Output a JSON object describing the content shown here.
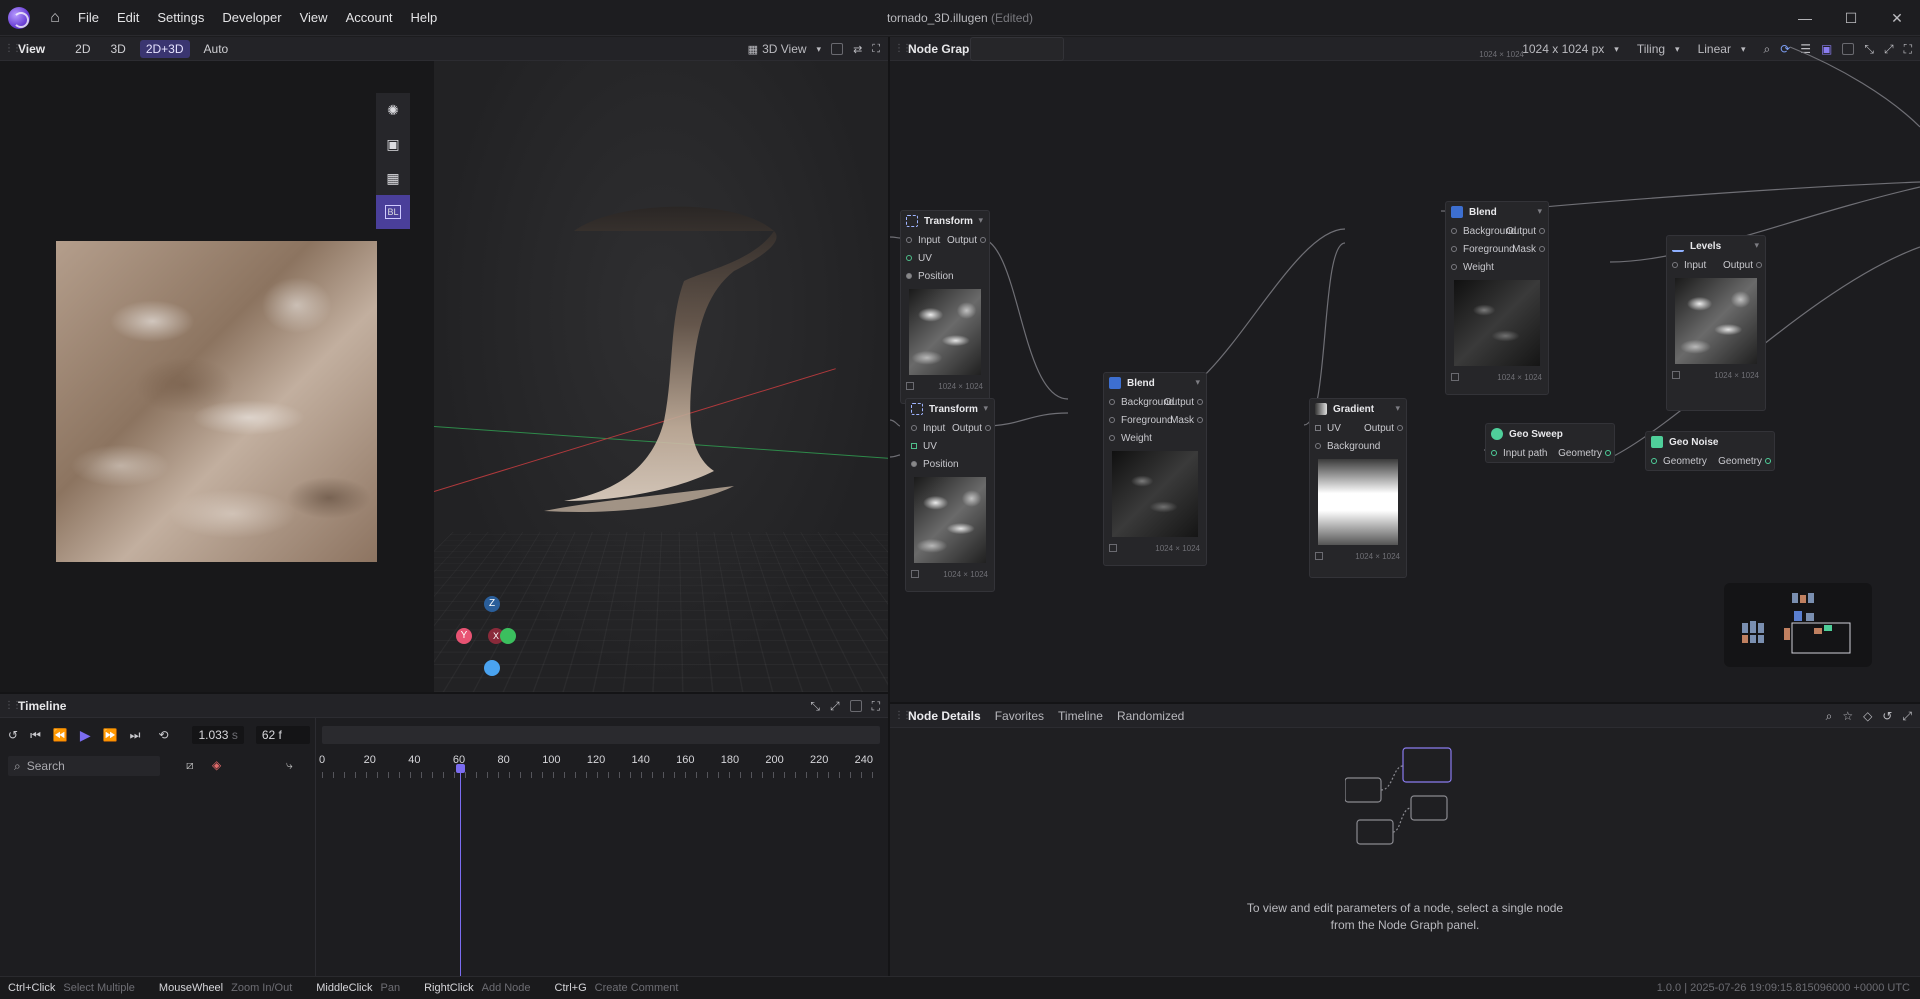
{
  "app": {
    "title": "tornado_3D.illugen",
    "edited": "(Edited)",
    "menu": [
      "File",
      "Edit",
      "Settings",
      "Developer",
      "View",
      "Account",
      "Help"
    ]
  },
  "view_panel": {
    "title": "View",
    "modes": [
      "2D",
      "3D",
      "2D+3D",
      "Auto"
    ],
    "active_mode": "2D+3D",
    "dropdown": "3D View",
    "gizmo": {
      "z": "Z",
      "y": "Y",
      "x": "X"
    },
    "tool_bl": "BL"
  },
  "node_graph": {
    "title": "Node Graph",
    "resolution": "1024 x 1024 px",
    "tiling": "Tiling",
    "filter": "Linear",
    "nodes": {
      "transform1": {
        "title": "Transform",
        "ports": [
          "Input",
          "UV",
          "Position"
        ],
        "output": "Output",
        "size": "1024 × 1024"
      },
      "transform2": {
        "title": "Transform",
        "ports": [
          "Input",
          "UV",
          "Position"
        ],
        "output": "Output",
        "size": "1024 × 1024"
      },
      "blend1": {
        "title": "Blend",
        "ports": [
          "Background",
          "Foreground",
          "Weight"
        ],
        "outputs": [
          "Output",
          "Mask"
        ],
        "size": "1024 × 1024"
      },
      "blend2": {
        "title": "Blend",
        "ports": [
          "Background",
          "Foreground",
          "Weight"
        ],
        "outputs": [
          "Output",
          "Mask"
        ],
        "size": "1024 × 1024"
      },
      "gradient": {
        "title": "Gradient",
        "ports": [
          "UV",
          "Background"
        ],
        "output": "Output",
        "size": "1024 × 1024"
      },
      "levels": {
        "title": "Levels",
        "ports": [
          "Input"
        ],
        "output": "Output",
        "size": "1024 × 1024"
      },
      "geo_sweep": {
        "title": "Geo Sweep",
        "ports": [
          "Input path"
        ],
        "output": "Geometry"
      },
      "geo_noise": {
        "title": "Geo Noise",
        "ports": [
          "Geometry"
        ],
        "output": "Geometry"
      },
      "top_node": {
        "size": "1024 × 1024"
      }
    }
  },
  "timeline": {
    "title": "Timeline",
    "time": "1.033",
    "time_unit": "s",
    "frame": "62 f",
    "search_placeholder": "Search",
    "ruler": [
      "0",
      "20",
      "40",
      "60",
      "80",
      "100",
      "120",
      "140",
      "160",
      "180",
      "200",
      "220",
      "240"
    ],
    "playhead_frame": 62,
    "max_frame": 250
  },
  "details": {
    "tabs": [
      "Node Details",
      "Favorites",
      "Timeline",
      "Randomized"
    ],
    "active_tab": "Node Details",
    "message_line1": "To view and edit parameters of a node, select a single node",
    "message_line2": "from the Node Graph panel."
  },
  "statusbar": {
    "hints": [
      {
        "key": "Ctrl+Click",
        "action": "Select Multiple"
      },
      {
        "key": "MouseWheel",
        "action": "Zoom In/Out"
      },
      {
        "key": "MiddleClick",
        "action": "Pan"
      },
      {
        "key": "RightClick",
        "action": "Add Node"
      },
      {
        "key": "Ctrl+G",
        "action": "Create Comment"
      }
    ],
    "version": "1.0.0  |  2025-07-26 19:09:15.815096000 +0000 UTC"
  },
  "colors": {
    "accent": "#7b6cf0",
    "active_bg": "#3a3570"
  }
}
